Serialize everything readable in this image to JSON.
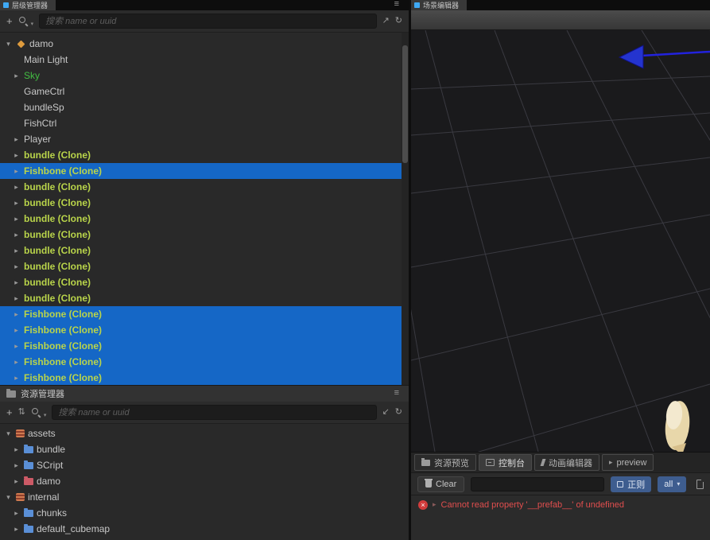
{
  "icons": {
    "menu": "≡",
    "plus": "+",
    "expand": "↗",
    "collapse": "↙",
    "refresh": "↻",
    "sort": "⇅",
    "caret_down": "▾",
    "caret_right": "▸",
    "close": "×",
    "play": "▸"
  },
  "hierarchy": {
    "tab_label": "层级管理器",
    "search_placeholder": "搜索 name or uuid",
    "items": [
      {
        "label": "damo",
        "arrow": "down",
        "kind": "scene-root",
        "selected": false
      },
      {
        "label": "Main Light",
        "arrow": "none",
        "kind": "node",
        "selected": false
      },
      {
        "label": "Sky",
        "arrow": "right",
        "kind": "node-green",
        "selected": false
      },
      {
        "label": "GameCtrl",
        "arrow": "none",
        "kind": "node",
        "selected": false
      },
      {
        "label": "bundleSp",
        "arrow": "none",
        "kind": "node",
        "selected": false
      },
      {
        "label": "FishCtrl",
        "arrow": "none",
        "kind": "node",
        "selected": false
      },
      {
        "label": "Player",
        "arrow": "right",
        "kind": "node",
        "selected": false
      },
      {
        "label": "bundle (Clone)",
        "arrow": "right",
        "kind": "prefab-clone",
        "selected": false
      },
      {
        "label": "Fishbone (Clone)",
        "arrow": "right",
        "kind": "prefab-clone",
        "selected": true
      },
      {
        "label": "bundle (Clone)",
        "arrow": "right",
        "kind": "prefab-clone",
        "selected": false
      },
      {
        "label": "bundle (Clone)",
        "arrow": "right",
        "kind": "prefab-clone",
        "selected": false
      },
      {
        "label": "bundle (Clone)",
        "arrow": "right",
        "kind": "prefab-clone",
        "selected": false
      },
      {
        "label": "bundle (Clone)",
        "arrow": "right",
        "kind": "prefab-clone",
        "selected": false
      },
      {
        "label": "bundle (Clone)",
        "arrow": "right",
        "kind": "prefab-clone",
        "selected": false
      },
      {
        "label": "bundle (Clone)",
        "arrow": "right",
        "kind": "prefab-clone",
        "selected": false
      },
      {
        "label": "bundle (Clone)",
        "arrow": "right",
        "kind": "prefab-clone",
        "selected": false
      },
      {
        "label": "bundle (Clone)",
        "arrow": "right",
        "kind": "prefab-clone",
        "selected": false
      },
      {
        "label": "Fishbone (Clone)",
        "arrow": "right",
        "kind": "prefab-clone",
        "selected": true
      },
      {
        "label": "Fishbone (Clone)",
        "arrow": "right",
        "kind": "prefab-clone",
        "selected": true
      },
      {
        "label": "Fishbone (Clone)",
        "arrow": "right",
        "kind": "prefab-clone",
        "selected": true
      },
      {
        "label": "Fishbone (Clone)",
        "arrow": "right",
        "kind": "prefab-clone",
        "selected": true
      },
      {
        "label": "Fishbone (Clone)",
        "arrow": "right",
        "kind": "prefab-clone",
        "selected": true
      }
    ]
  },
  "assets_panel": {
    "title": "资源管理器",
    "search_placeholder": "搜索 name or uuid",
    "items": [
      {
        "label": "assets",
        "arrow": "down",
        "icon": "assets-db"
      },
      {
        "label": "bundle",
        "arrow": "right",
        "icon": "folder-blue"
      },
      {
        "label": "SCript",
        "arrow": "right",
        "icon": "folder-blue"
      },
      {
        "label": "damo",
        "arrow": "right",
        "icon": "folder-red"
      },
      {
        "label": "internal",
        "arrow": "down",
        "icon": "assets-db"
      },
      {
        "label": "chunks",
        "arrow": "right",
        "icon": "folder-blue"
      },
      {
        "label": "default_cubemap",
        "arrow": "right",
        "icon": "folder-blue"
      }
    ]
  },
  "scene": {
    "tab_label": "场景编辑器"
  },
  "console": {
    "tabs": [
      {
        "label": "资源预览"
      },
      {
        "label": "控制台"
      },
      {
        "label": "动画编辑器"
      },
      {
        "label": "preview"
      }
    ],
    "clear_label": "Clear",
    "filter_input_value": "",
    "regex_label": "正则",
    "filter_value": "all",
    "error_message": "Cannot read property '__prefab__' of undefined"
  }
}
